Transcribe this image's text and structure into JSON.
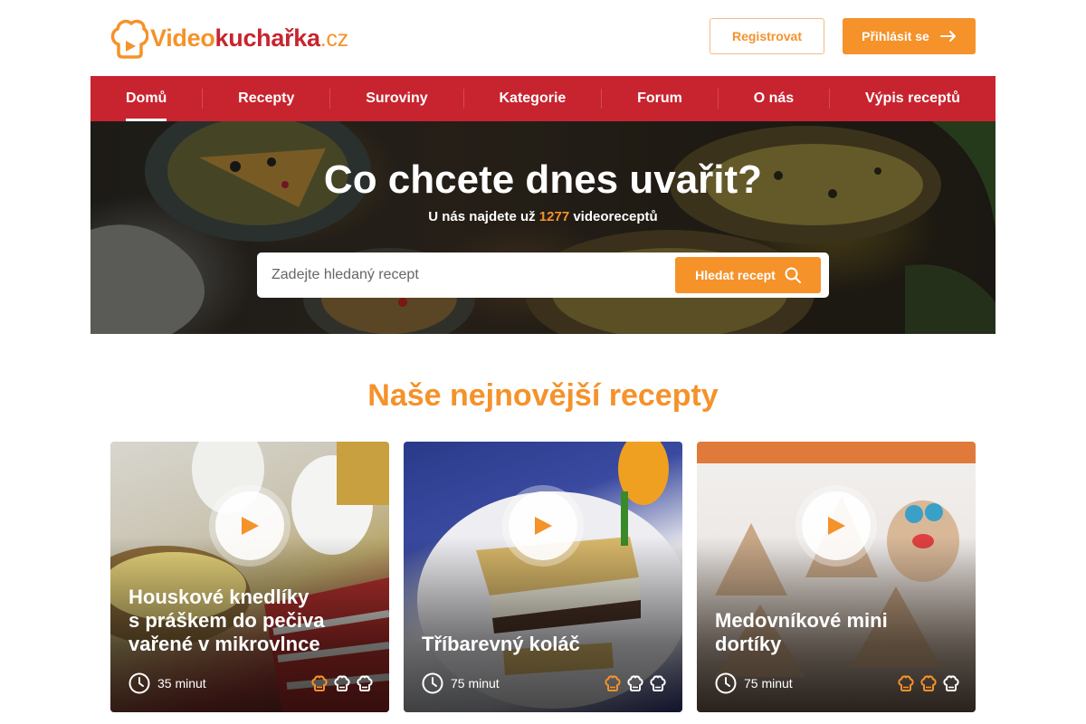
{
  "header": {
    "logo": {
      "part1": "Video",
      "part2": "kuchařka",
      "part3": ".cz"
    },
    "register_label": "Registrovat",
    "login_label": "Přihlásit se"
  },
  "nav": {
    "items": [
      {
        "label": "Domů",
        "active": true
      },
      {
        "label": "Recepty"
      },
      {
        "label": "Suroviny"
      },
      {
        "label": "Kategorie"
      },
      {
        "label": "Forum"
      },
      {
        "label": "O nás"
      },
      {
        "label": "Výpis receptů"
      }
    ]
  },
  "hero": {
    "title": "Co chcete dnes uvařit?",
    "sub_prefix": "U nás najdete už",
    "recipe_count": "1277",
    "sub_suffix": "videoreceptů",
    "search_placeholder": "Zadejte hledaný recept",
    "search_button": "Hledat recept"
  },
  "section": {
    "title": "Naše nejnovější recepty"
  },
  "cards": [
    {
      "title_lines": [
        "Houskové knedlíky",
        "s práškem do pečiva",
        "vařené v mikrovlnce"
      ],
      "time": "35 minut",
      "difficulty": 1,
      "difficulty_max": 3
    },
    {
      "title_lines": [
        "Tříbarevný koláč"
      ],
      "time": "75 minut",
      "difficulty": 1,
      "difficulty_max": 3
    },
    {
      "title_lines": [
        "Medovníkové mini",
        "dortíky"
      ],
      "time": "75 minut",
      "difficulty": 2,
      "difficulty_max": 3
    }
  ],
  "colors": {
    "brand_orange": "#f5922a",
    "brand_red": "#c8242f"
  },
  "icons": {
    "login": "arrow-right-icon",
    "search": "magnifier-icon",
    "play": "play-icon",
    "time": "clock-icon",
    "difficulty": "chef-hat-icon"
  }
}
